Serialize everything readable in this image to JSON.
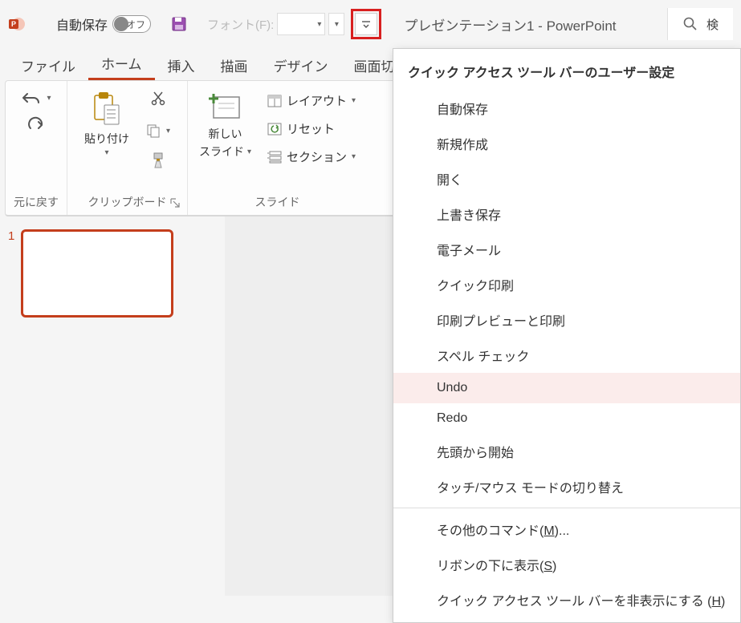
{
  "titlebar": {
    "autosave_label": "自動保存",
    "autosave_state": "オフ",
    "font_label": "フォント(F):",
    "doc_title": "プレゼンテーション1  -  PowerPoint",
    "search_placeholder": "検"
  },
  "tabs": {
    "file": "ファイル",
    "home": "ホーム",
    "insert": "挿入",
    "draw": "描画",
    "design": "デザイン",
    "transition": "画面切り替"
  },
  "ribbon": {
    "undo_group": "元に戻す",
    "clipboard_group": "クリップボード",
    "paste": "貼り付け",
    "slides_group": "スライド",
    "new_slide_l1": "新しい",
    "new_slide_l2": "スライド",
    "layout": "レイアウト",
    "reset": "リセット",
    "section": "セクション"
  },
  "thumbnails": {
    "first_num": "1"
  },
  "dropdown": {
    "header": "クイック アクセス ツール バーのユーザー設定",
    "items": {
      "autosave": "自動保存",
      "new": "新規作成",
      "open": "開く",
      "save": "上書き保存",
      "email": "電子メール",
      "quickprint": "クイック印刷",
      "printpreview": "印刷プレビューと印刷",
      "spellcheck": "スペル チェック",
      "undo": "Undo",
      "redo": "Redo",
      "startshow": "先頭から開始",
      "touchmouse": "タッチ/マウス モードの切り替え",
      "morecommands_pre": "その他のコマンド(",
      "morecommands_u": "M",
      "morecommands_post": ")...",
      "showbelow_pre": "リボンの下に表示(",
      "showbelow_u": "S",
      "showbelow_post": ")",
      "hide_pre": "クイック アクセス ツール バーを非表示にする (",
      "hide_u": "H",
      "hide_post": ")"
    }
  }
}
